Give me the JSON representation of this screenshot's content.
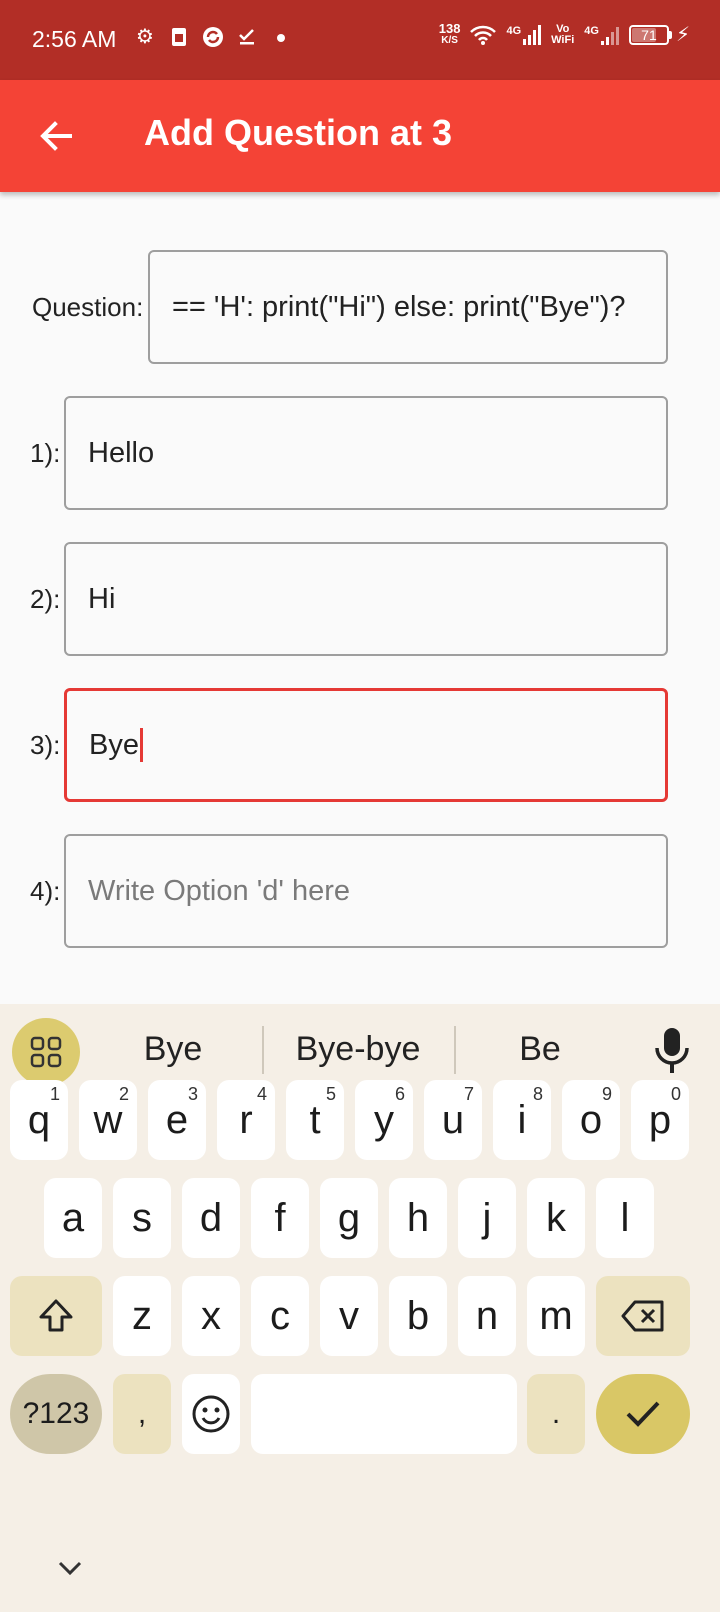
{
  "status_bar": {
    "time": "2:56 AM",
    "icons": [
      "settings-gear-icon",
      "sim-card-icon",
      "sync-icon",
      "check-icon",
      "dot-icon"
    ],
    "speed_value": "138",
    "speed_unit": "K/S",
    "net1_label": "4G",
    "volte_line1": "Vo",
    "volte_line2": "WiFi",
    "net2_label": "4G",
    "battery": "71"
  },
  "app_bar": {
    "title": "Add Question at 3",
    "back_icon": "arrow-back-icon",
    "color": "#f44336"
  },
  "form": {
    "question_label": "Question:",
    "question_value": "== 'H': print(\"Hi\") else: print(\"Bye\")?",
    "options": [
      {
        "label": "1):",
        "value": "Hello",
        "placeholder": ""
      },
      {
        "label": "2):",
        "value": "Hi",
        "placeholder": ""
      },
      {
        "label": "3):",
        "value": "Bye",
        "placeholder": ""
      },
      {
        "label": "4):",
        "value": "",
        "placeholder": "Write Option 'd' here"
      }
    ],
    "focus_color": "#e53935"
  },
  "keyboard": {
    "suggestions": [
      "Bye",
      "Bye-bye",
      "Be"
    ],
    "row1": [
      {
        "key": "q",
        "hint": "1"
      },
      {
        "key": "w",
        "hint": "2"
      },
      {
        "key": "e",
        "hint": "3"
      },
      {
        "key": "r",
        "hint": "4"
      },
      {
        "key": "t",
        "hint": "5"
      },
      {
        "key": "y",
        "hint": "6"
      },
      {
        "key": "u",
        "hint": "7"
      },
      {
        "key": "i",
        "hint": "8"
      },
      {
        "key": "o",
        "hint": "9"
      },
      {
        "key": "p",
        "hint": "0"
      }
    ],
    "row2": [
      "a",
      "s",
      "d",
      "f",
      "g",
      "h",
      "j",
      "k",
      "l"
    ],
    "row3": [
      "z",
      "x",
      "c",
      "v",
      "b",
      "n",
      "m"
    ],
    "symbols_label": "?123",
    "comma": ",",
    "period": "."
  }
}
